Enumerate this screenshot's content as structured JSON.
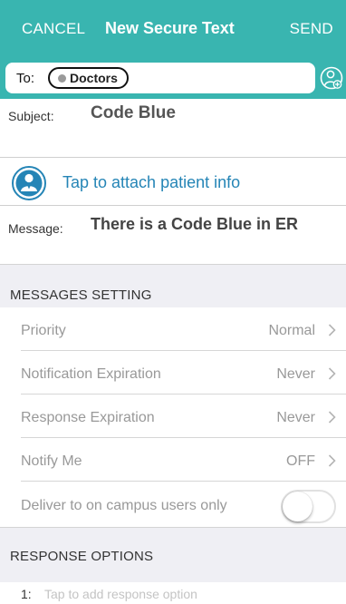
{
  "colors": {
    "accent": "#39b5b0",
    "link": "#2585b6",
    "section_background": "#efeff4"
  },
  "navbar": {
    "cancel_label": "CANCEL",
    "title": "New Secure Text",
    "send_label": "SEND"
  },
  "recipient": {
    "label": "To:",
    "chip_text": "Doctors",
    "add_icon": "add-contact-icon"
  },
  "subject": {
    "label": "Subject:",
    "value": "Code Blue"
  },
  "attach": {
    "icon": "patient-icon",
    "label": "Tap to attach patient info"
  },
  "message": {
    "label": "Message:",
    "value": "There is a Code Blue in ER"
  },
  "settings": {
    "header": "MESSAGES SETTING",
    "items": [
      {
        "label": "Priority",
        "value": "Normal"
      },
      {
        "label": "Notification Expiration",
        "value": "Never"
      },
      {
        "label": "Response Expiration",
        "value": "Never"
      },
      {
        "label": "Notify Me",
        "value": "OFF"
      }
    ],
    "campus_toggle": {
      "label": "Deliver to on campus users only",
      "state": "off"
    }
  },
  "response_options": {
    "header": "RESPONSE OPTIONS",
    "items": [
      {
        "number": "1:",
        "placeholder": "Tap to add response option"
      }
    ]
  }
}
